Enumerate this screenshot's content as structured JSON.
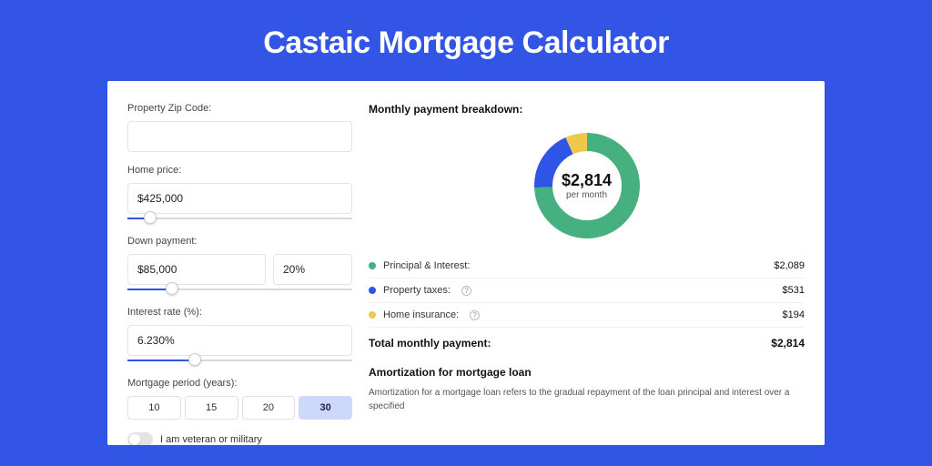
{
  "title": "Castaic Mortgage Calculator",
  "form": {
    "zip": {
      "label": "Property Zip Code:",
      "value": ""
    },
    "home_price": {
      "label": "Home price:",
      "value": "$425,000",
      "slider_pct": 10
    },
    "down_payment": {
      "label": "Down payment:",
      "value": "$85,000",
      "pct_value": "20%",
      "slider_pct": 20
    },
    "interest_rate": {
      "label": "Interest rate (%):",
      "value": "6.230%",
      "slider_pct": 30
    },
    "period": {
      "label": "Mortgage period (years):",
      "options": [
        "10",
        "15",
        "20",
        "30"
      ],
      "active": "30"
    },
    "veteran": {
      "label": "I am veteran or military",
      "on": false
    }
  },
  "breakdown": {
    "title": "Monthly payment breakdown:",
    "center_amount": "$2,814",
    "center_sub": "per month",
    "items": [
      {
        "label": "Principal & Interest:",
        "value": "$2,089",
        "info": false
      },
      {
        "label": "Property taxes:",
        "value": "$531",
        "info": true
      },
      {
        "label": "Home insurance:",
        "value": "$194",
        "info": true
      }
    ],
    "total_label": "Total monthly payment:",
    "total_value": "$2,814"
  },
  "amortization": {
    "title": "Amortization for mortgage loan",
    "text": "Amortization for a mortgage loan refers to the gradual repayment of the loan principal and interest over a specified"
  },
  "chart_data": {
    "type": "pie",
    "series": [
      {
        "name": "Principal & Interest",
        "value": 2089,
        "color": "#46b081"
      },
      {
        "name": "Property taxes",
        "value": 531,
        "color": "#2e55e6"
      },
      {
        "name": "Home insurance",
        "value": 194,
        "color": "#edc84a"
      }
    ],
    "total": 2814
  }
}
